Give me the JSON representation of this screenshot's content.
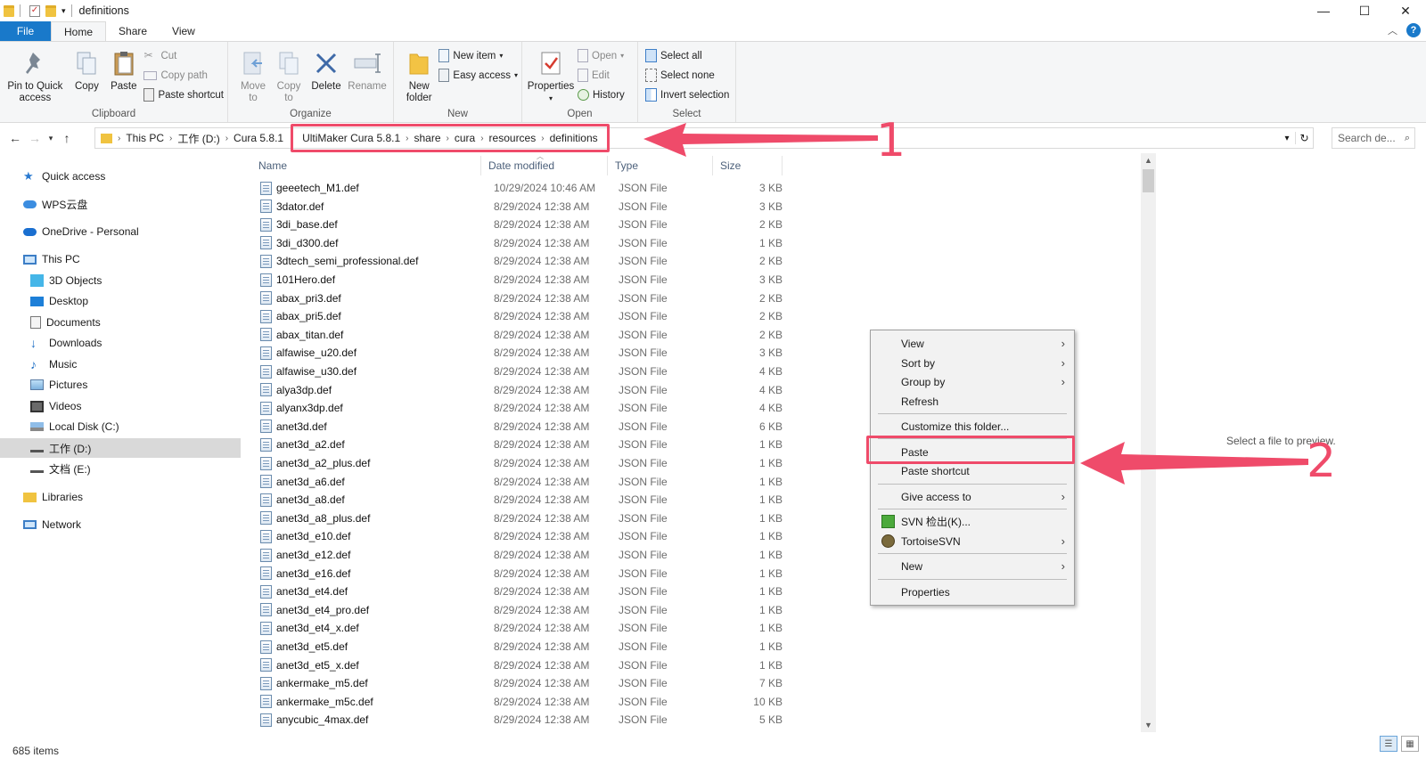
{
  "window": {
    "title": "definitions",
    "controls": [
      "—",
      "☐",
      "✕"
    ]
  },
  "tabs": {
    "file": "File",
    "home": "Home",
    "share": "Share",
    "view": "View"
  },
  "ribbon": {
    "clipboard": {
      "label": "Clipboard",
      "pin": "Pin to Quick access",
      "copy": "Copy",
      "paste": "Paste",
      "cut": "Cut",
      "copy_path": "Copy path",
      "paste_shortcut": "Paste shortcut"
    },
    "organize": {
      "label": "Organize",
      "move_to": "Move to",
      "copy_to": "Copy to",
      "delete": "Delete",
      "rename": "Rename"
    },
    "new": {
      "label": "New",
      "new_folder": "New folder",
      "new_item": "New item",
      "easy_access": "Easy access"
    },
    "open": {
      "label": "Open",
      "properties": "Properties",
      "open": "Open",
      "edit": "Edit",
      "history": "History"
    },
    "select": {
      "label": "Select",
      "select_all": "Select all",
      "select_none": "Select none",
      "invert": "Invert selection"
    }
  },
  "address": {
    "crumbs_plain": [
      "This PC",
      "工作 (D:)",
      "Cura 5.8.1"
    ],
    "crumbs_highlight": [
      "UltiMaker Cura 5.8.1",
      "share",
      "cura",
      "resources",
      "definitions"
    ],
    "search_placeholder": "Search de..."
  },
  "sidebar": {
    "quick_access": "Quick access",
    "wps": "WPS云盘",
    "onedrive": "OneDrive - Personal",
    "this_pc": "This PC",
    "objects3d": "3D Objects",
    "desktop": "Desktop",
    "documents": "Documents",
    "downloads": "Downloads",
    "music": "Music",
    "pictures": "Pictures",
    "videos": "Videos",
    "local_c": "Local Disk (C:)",
    "drive_d": "工作 (D:)",
    "drive_e": "文档 (E:)",
    "libraries": "Libraries",
    "network": "Network"
  },
  "columns": {
    "name": "Name",
    "date": "Date modified",
    "type": "Type",
    "size": "Size"
  },
  "files": [
    {
      "name": "geeetech_M1.def",
      "date": "10/29/2024 10:46 AM",
      "type": "JSON File",
      "size": "3 KB"
    },
    {
      "name": "3dator.def",
      "date": "8/29/2024 12:38 AM",
      "type": "JSON File",
      "size": "3 KB"
    },
    {
      "name": "3di_base.def",
      "date": "8/29/2024 12:38 AM",
      "type": "JSON File",
      "size": "2 KB"
    },
    {
      "name": "3di_d300.def",
      "date": "8/29/2024 12:38 AM",
      "type": "JSON File",
      "size": "1 KB"
    },
    {
      "name": "3dtech_semi_professional.def",
      "date": "8/29/2024 12:38 AM",
      "type": "JSON File",
      "size": "2 KB"
    },
    {
      "name": "101Hero.def",
      "date": "8/29/2024 12:38 AM",
      "type": "JSON File",
      "size": "3 KB"
    },
    {
      "name": "abax_pri3.def",
      "date": "8/29/2024 12:38 AM",
      "type": "JSON File",
      "size": "2 KB"
    },
    {
      "name": "abax_pri5.def",
      "date": "8/29/2024 12:38 AM",
      "type": "JSON File",
      "size": "2 KB"
    },
    {
      "name": "abax_titan.def",
      "date": "8/29/2024 12:38 AM",
      "type": "JSON File",
      "size": "2 KB"
    },
    {
      "name": "alfawise_u20.def",
      "date": "8/29/2024 12:38 AM",
      "type": "JSON File",
      "size": "3 KB"
    },
    {
      "name": "alfawise_u30.def",
      "date": "8/29/2024 12:38 AM",
      "type": "JSON File",
      "size": "4 KB"
    },
    {
      "name": "alya3dp.def",
      "date": "8/29/2024 12:38 AM",
      "type": "JSON File",
      "size": "4 KB"
    },
    {
      "name": "alyanx3dp.def",
      "date": "8/29/2024 12:38 AM",
      "type": "JSON File",
      "size": "4 KB"
    },
    {
      "name": "anet3d.def",
      "date": "8/29/2024 12:38 AM",
      "type": "JSON File",
      "size": "6 KB"
    },
    {
      "name": "anet3d_a2.def",
      "date": "8/29/2024 12:38 AM",
      "type": "JSON File",
      "size": "1 KB"
    },
    {
      "name": "anet3d_a2_plus.def",
      "date": "8/29/2024 12:38 AM",
      "type": "JSON File",
      "size": "1 KB"
    },
    {
      "name": "anet3d_a6.def",
      "date": "8/29/2024 12:38 AM",
      "type": "JSON File",
      "size": "1 KB"
    },
    {
      "name": "anet3d_a8.def",
      "date": "8/29/2024 12:38 AM",
      "type": "JSON File",
      "size": "1 KB"
    },
    {
      "name": "anet3d_a8_plus.def",
      "date": "8/29/2024 12:38 AM",
      "type": "JSON File",
      "size": "1 KB"
    },
    {
      "name": "anet3d_e10.def",
      "date": "8/29/2024 12:38 AM",
      "type": "JSON File",
      "size": "1 KB"
    },
    {
      "name": "anet3d_e12.def",
      "date": "8/29/2024 12:38 AM",
      "type": "JSON File",
      "size": "1 KB"
    },
    {
      "name": "anet3d_e16.def",
      "date": "8/29/2024 12:38 AM",
      "type": "JSON File",
      "size": "1 KB"
    },
    {
      "name": "anet3d_et4.def",
      "date": "8/29/2024 12:38 AM",
      "type": "JSON File",
      "size": "1 KB"
    },
    {
      "name": "anet3d_et4_pro.def",
      "date": "8/29/2024 12:38 AM",
      "type": "JSON File",
      "size": "1 KB"
    },
    {
      "name": "anet3d_et4_x.def",
      "date": "8/29/2024 12:38 AM",
      "type": "JSON File",
      "size": "1 KB"
    },
    {
      "name": "anet3d_et5.def",
      "date": "8/29/2024 12:38 AM",
      "type": "JSON File",
      "size": "1 KB"
    },
    {
      "name": "anet3d_et5_x.def",
      "date": "8/29/2024 12:38 AM",
      "type": "JSON File",
      "size": "1 KB"
    },
    {
      "name": "ankermake_m5.def",
      "date": "8/29/2024 12:38 AM",
      "type": "JSON File",
      "size": "7 KB"
    },
    {
      "name": "ankermake_m5c.def",
      "date": "8/29/2024 12:38 AM",
      "type": "JSON File",
      "size": "10 KB"
    },
    {
      "name": "anycubic_4max.def",
      "date": "8/29/2024 12:38 AM",
      "type": "JSON File",
      "size": "5 KB"
    }
  ],
  "preview": "Select a file to preview.",
  "context_menu": {
    "view": "View",
    "sort_by": "Sort by",
    "group_by": "Group by",
    "refresh": "Refresh",
    "customize": "Customize this folder...",
    "paste": "Paste",
    "paste_shortcut": "Paste shortcut",
    "give_access": "Give access to",
    "svn_checkout": "SVN 检出(K)...",
    "tortoise": "TortoiseSVN",
    "new": "New",
    "properties": "Properties"
  },
  "status": {
    "items": "685 items"
  },
  "annotations": {
    "one": "1",
    "two": "2",
    "color": "#ef4b6a"
  }
}
